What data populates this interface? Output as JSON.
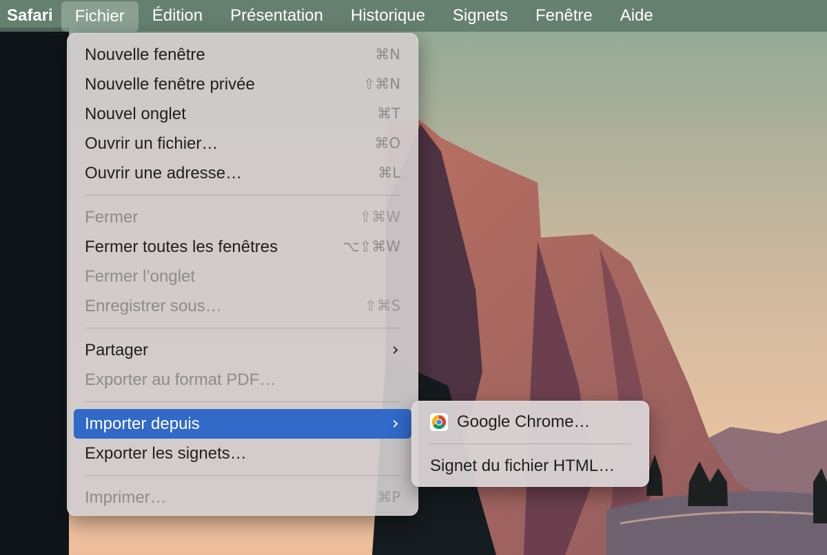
{
  "menubar": {
    "app": "Safari",
    "items": [
      "Fichier",
      "Édition",
      "Présentation",
      "Historique",
      "Signets",
      "Fenêtre",
      "Aide"
    ],
    "active": "Fichier"
  },
  "file_menu": {
    "items": [
      {
        "label": "Nouvelle fenêtre",
        "shortcut": "⌘N",
        "enabled": true
      },
      {
        "label": "Nouvelle fenêtre privée",
        "shortcut": "⇧⌘N",
        "enabled": true
      },
      {
        "label": "Nouvel onglet",
        "shortcut": "⌘T",
        "enabled": true
      },
      {
        "label": "Ouvrir un fichier…",
        "shortcut": "⌘O",
        "enabled": true
      },
      {
        "label": "Ouvrir une adresse…",
        "shortcut": "⌘L",
        "enabled": true
      },
      {
        "label": "Fermer",
        "shortcut": "⇧⌘W",
        "enabled": false
      },
      {
        "label": "Fermer toutes les fenêtres",
        "shortcut": "⌥⇧⌘W",
        "enabled": true
      },
      {
        "label": "Fermer l’onglet",
        "shortcut": "",
        "enabled": false
      },
      {
        "label": "Enregistrer sous…",
        "shortcut": "⇧⌘S",
        "enabled": false
      },
      {
        "label": "Partager",
        "submenu": true,
        "enabled": true
      },
      {
        "label": "Exporter au format PDF…",
        "shortcut": "",
        "enabled": false
      },
      {
        "label": "Importer depuis",
        "submenu": true,
        "enabled": true,
        "highlighted": true
      },
      {
        "label": "Exporter les signets…",
        "shortcut": "",
        "enabled": true
      },
      {
        "label": "Imprimer…",
        "shortcut": "⌘P",
        "enabled": false
      }
    ]
  },
  "import_submenu": {
    "items": [
      {
        "label": "Google Chrome…",
        "icon": "chrome-icon"
      },
      {
        "label": "Signet du fichier HTML…"
      }
    ]
  },
  "colors": {
    "highlight": "#3169c9",
    "menubar": "#5c7667"
  }
}
